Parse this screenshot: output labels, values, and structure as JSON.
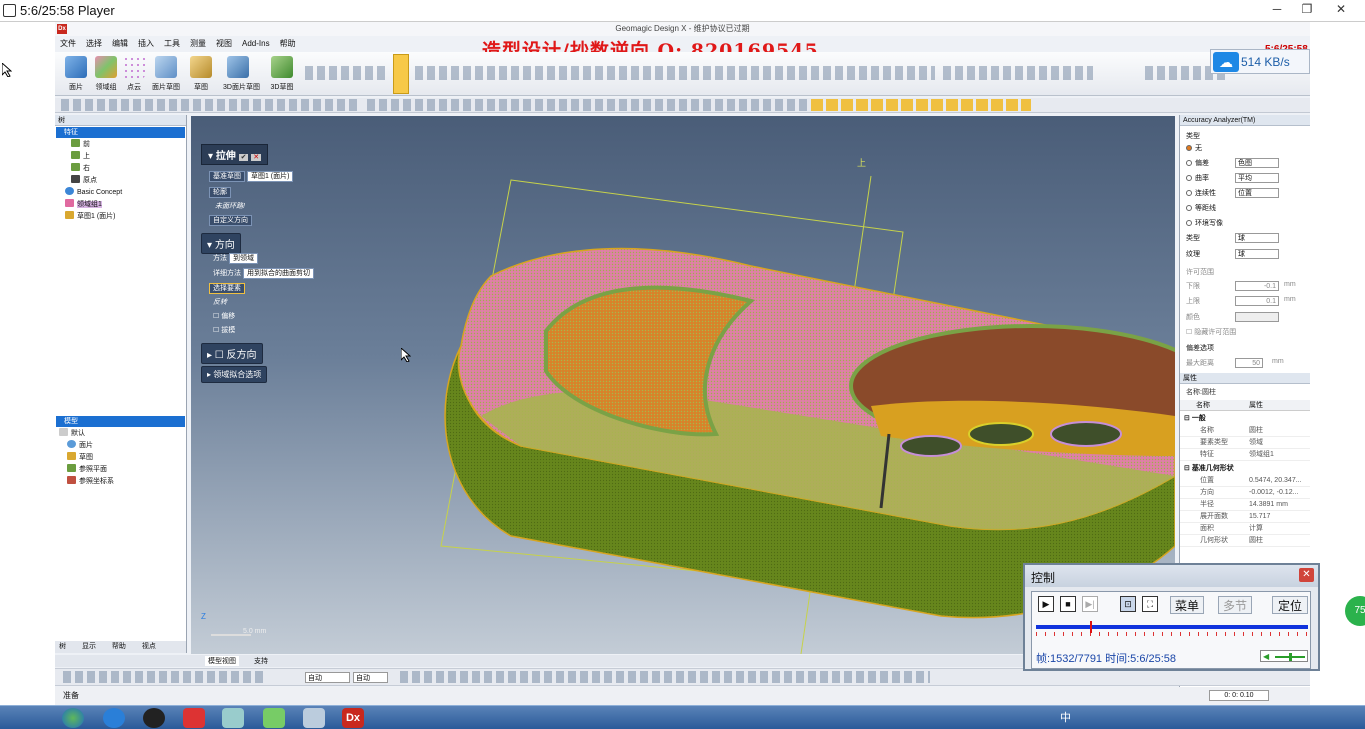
{
  "player": {
    "title": "5:6/25:58 Player",
    "minimize": "─",
    "restore": "❐",
    "close": "✕"
  },
  "app": {
    "title": "Geomagic Design X - 维护协议已过期",
    "logo": "Dx",
    "watermark": "造型设计/抄数逆向    Q: 820169545",
    "menus": [
      "文件",
      "选择",
      "编辑",
      "插入",
      "工具",
      "测量",
      "视图",
      "Add-Ins",
      "帮助"
    ],
    "ribbon_buttons": [
      "面片",
      "领域组",
      "点云",
      "面片草图",
      "草图",
      "3D面片草图",
      "3D草图"
    ],
    "countdown": "5:6/25:58",
    "speed": "514 KB/s"
  },
  "tree": {
    "header": "树",
    "features_section": "特征",
    "features": [
      "前",
      "上",
      "右",
      "原点",
      "Basic Concept",
      "领域组1",
      "草图1 (面片)"
    ],
    "model_section": "模型",
    "model_default": "默认",
    "model_items": [
      "面片",
      "草图",
      "参照平面",
      "参照坐标系"
    ],
    "bottom_tabs": [
      "树",
      "显示",
      "帮助",
      "视点"
    ]
  },
  "extrude_dialog": {
    "title": "拉伸",
    "base_sketch_label": "基准草图",
    "base_sketch_value": "草图1 (面片)",
    "profile_label": "轮廓",
    "profile_note": "未面环路!",
    "custom_direction": "自定义方向",
    "direction_title": "方向",
    "method_label": "方法",
    "method_value": "到领域",
    "detail_label": "详细方法",
    "detail_value": "用到拟合的曲面剪切",
    "select_element": "选择要素",
    "reverse": "反转",
    "offset": "偏移",
    "draft": "拔模",
    "reverse_direction": "反方向",
    "region_fit": "领域拟合选项"
  },
  "viewport": {
    "up_label": "上",
    "scale_label": "5.0 mm",
    "axis_z": "Z"
  },
  "accuracy": {
    "title": "Accuracy Analyzer(TM)",
    "type_label": "类型",
    "options": [
      "无",
      "偏差",
      "曲率",
      "连续性",
      "等距线",
      "环境写像"
    ],
    "sel_deviation": "色图",
    "sel_curvature": "平均",
    "sel_continuity": "位置",
    "type2_label": "类型",
    "type2_value": "球",
    "texture_label": "纹理",
    "texture_value": "球",
    "tolerance_title": "许可范围",
    "lower_label": "下限",
    "lower_value": "-0.1",
    "upper_label": "上限",
    "upper_value": "0.1",
    "color_label": "颜色",
    "hide_tolerance": "隐藏许可范围",
    "deviation_options": "偏差选项",
    "max_dist_label": "最大距离",
    "max_dist_value": "50",
    "unit": "mm"
  },
  "properties": {
    "title": "属性",
    "filter": "名称:圆柱",
    "col_name": "名称",
    "col_attr": "属性",
    "general": "一般",
    "rows": [
      [
        "名称",
        "圆柱"
      ],
      [
        "要素类型",
        "领域"
      ],
      [
        "特征",
        "领域组1"
      ]
    ],
    "geometry": "基准几何形状",
    "geo_rows": [
      [
        "位置",
        "0.5474, 20.347..."
      ],
      [
        "方向",
        "-0.0012, -0.12..."
      ],
      [
        "半径",
        "14.3891 mm"
      ],
      [
        "展开面数",
        "15.717"
      ],
      [
        "面积",
        "计算"
      ],
      [
        "几何形状",
        "圆柱"
      ]
    ]
  },
  "bottom": {
    "tabs": [
      "模型视图",
      "支持"
    ],
    "mode1": "自动",
    "mode2": "自动",
    "status": "准备",
    "time": "0: 0: 0.10"
  },
  "control": {
    "title": "控制",
    "close": "✕",
    "menu": "菜单",
    "chapter": "多节",
    "locate": "定位",
    "frame_info": "帧:1532/7791 时间:5:6/25:58",
    "progress": 0.197
  },
  "taskbar": {
    "tray_text": "中",
    "badge": "75"
  },
  "colors": {
    "accent": "#1b6fd1",
    "watermark": "#e01818",
    "model_green": "#6e8f1e",
    "model_pink": "#e07fa8",
    "model_orange": "#d9822a"
  }
}
